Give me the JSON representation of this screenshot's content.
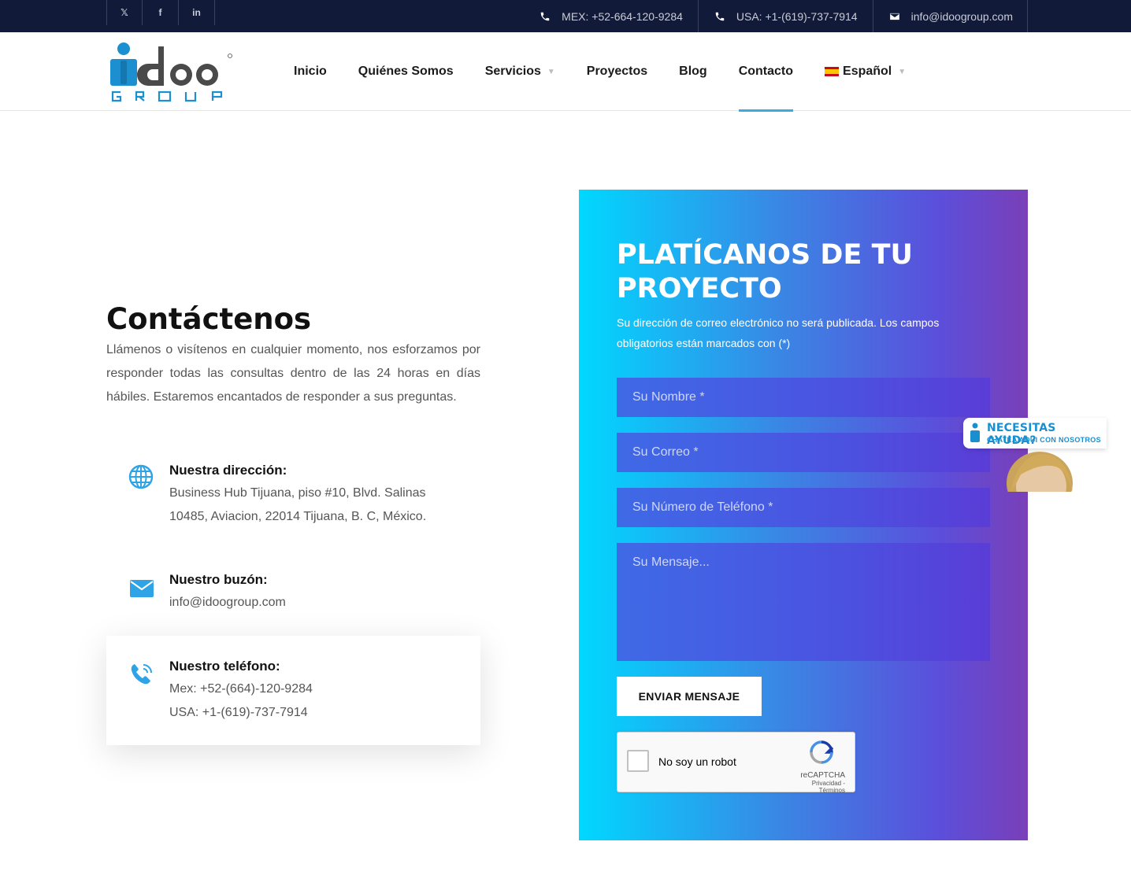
{
  "topbar": {
    "social": [
      {
        "icon": "twitter-icon",
        "glyph": "𝕏"
      },
      {
        "icon": "facebook-icon",
        "glyph": "f"
      },
      {
        "icon": "linkedin-icon",
        "glyph": "in"
      }
    ],
    "contacts": [
      {
        "icon": "phone-icon",
        "text": "MEX: +52-664-120-9284"
      },
      {
        "icon": "phone-icon",
        "text": "USA: +1-(619)-737-7914"
      },
      {
        "icon": "envelope-icon",
        "text": "info@idoogroup.com"
      }
    ]
  },
  "header": {
    "nav": [
      {
        "label": "Inicio"
      },
      {
        "label": "Quiénes Somos"
      },
      {
        "label": "Servicios",
        "dropdown": true
      },
      {
        "label": "Proyectos"
      },
      {
        "label": "Blog"
      },
      {
        "label": "Contacto",
        "active": true
      },
      {
        "label": "Español",
        "dropdown": true,
        "flag": "es"
      }
    ]
  },
  "contact": {
    "title": "Contáctenos",
    "intro": "Llámenos o visítenos en cualquier momento, nos esforzamos por responder todas las consultas dentro de las 24 horas en días hábiles. Estaremos encantados de responder a sus preguntas.",
    "address": {
      "label": "Nuestra dirección:",
      "line1": "Business Hub Tijuana, piso #10, Blvd. Salinas",
      "line2": "10485, Aviacion, 22014 Tijuana, B. C, México."
    },
    "mailbox": {
      "label": "Nuestro buzón:",
      "line1": "info@idoogroup.com"
    },
    "phone": {
      "label": "Nuestro teléfono:",
      "line1": "Mex: +52-(664)-120-9284",
      "line2": "USA: +1-(619)-737-7914"
    }
  },
  "form": {
    "title": "PLATÍCANOS DE TU PROYECTO",
    "note": "Su dirección de correo electrónico no será publicada. Los campos obligatorios están marcados con (*)",
    "name_placeholder": "Su Nombre *",
    "email_placeholder": "Su Correo *",
    "phone_placeholder": "Su Número de Teléfono *",
    "message_placeholder": "Su Mensaje...",
    "submit_label": "ENVIAR MENSAJE",
    "captcha": {
      "label": "No soy un robot",
      "brand": "reCAPTCHA",
      "links": "Privacidad - Términos"
    }
  },
  "help_widget": {
    "title": "NECESITAS AYUDA?",
    "subtitle": "CHATEA AQUI CON NOSOTROS"
  },
  "colors": {
    "topbar": "#111a38",
    "accent": "#3aaae0",
    "gradient_start": "#00d8ff",
    "gradient_end": "#7a3fb8"
  }
}
